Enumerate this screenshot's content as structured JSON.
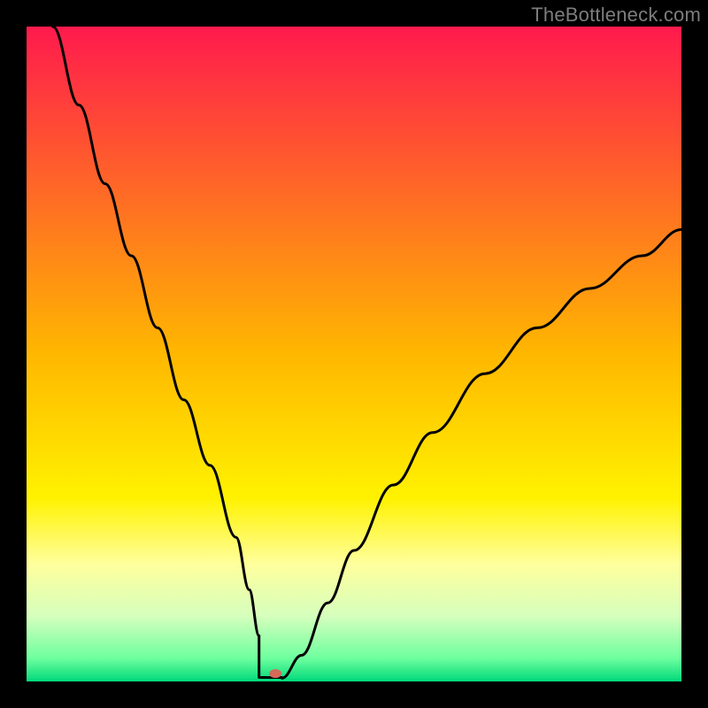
{
  "watermark": "TheBottleneck.com",
  "chart_data": {
    "type": "line",
    "title": "",
    "xlabel": "",
    "ylabel": "",
    "xlim": [
      0,
      100
    ],
    "ylim": [
      0,
      100
    ],
    "gradient_stops": [
      {
        "offset": 0,
        "color": "#ff1a4d"
      },
      {
        "offset": 0.5,
        "color": "#ffb700"
      },
      {
        "offset": 0.72,
        "color": "#fff200"
      },
      {
        "offset": 0.82,
        "color": "#ffff9c"
      },
      {
        "offset": 0.9,
        "color": "#d6ffbd"
      },
      {
        "offset": 0.965,
        "color": "#6dff9e"
      },
      {
        "offset": 1.0,
        "color": "#00d97a"
      }
    ],
    "series": [
      {
        "name": "bottleneck-curve",
        "x": [
          4,
          8,
          12,
          16,
          20,
          24,
          28,
          32,
          34,
          35.5,
          37,
          38,
          39,
          42,
          46,
          50,
          56,
          62,
          70,
          78,
          86,
          94,
          100
        ],
        "y": [
          100,
          88,
          76,
          65,
          54,
          43,
          33,
          22,
          14,
          7,
          1.5,
          0.5,
          0.5,
          4,
          12,
          20,
          30,
          38,
          47,
          54,
          60,
          65,
          69
        ]
      }
    ],
    "flat_bottom": {
      "x_start": 35.5,
      "x_end": 39,
      "y": 0.6
    },
    "marker": {
      "x": 38,
      "y": 1.2,
      "color": "#d46a5a",
      "rx": 7,
      "ry": 5
    }
  }
}
